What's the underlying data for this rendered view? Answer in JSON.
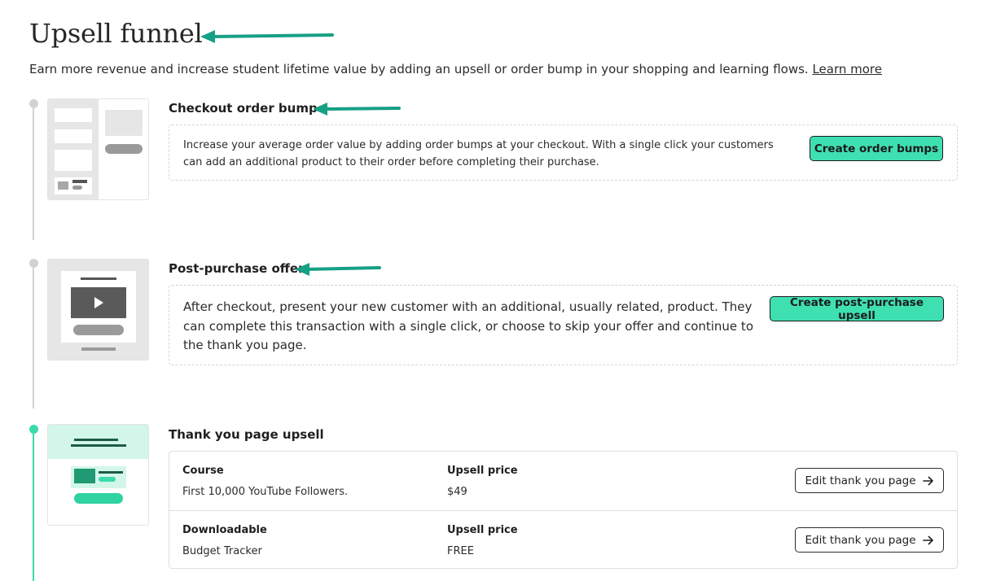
{
  "header": {
    "title": "Upsell funnel",
    "description": "Earn more revenue and increase student lifetime value by adding an upsell or order bump in your shopping and learning flows.",
    "learn_more": "Learn more"
  },
  "colors": {
    "accent": "#3ee0b2",
    "arrow": "#16a085",
    "timeline_inactive": "#d2d2d2",
    "timeline_active": "#3dd9ad"
  },
  "sections": {
    "order_bump": {
      "title": "Checkout order bump",
      "description": "Increase your average order value by adding order bumps at your checkout. With a single click your customers can add an additional product to their order before completing their purchase.",
      "button": "Create order bumps"
    },
    "post_purchase": {
      "title": "Post-purchase offer",
      "description": "After checkout, present your new customer with an additional, usually related, product. They can complete this transaction with a single click, or choose to skip your offer and continue to the thank you page.",
      "button": "Create post-purchase upsell"
    },
    "thank_you": {
      "title": "Thank you page upsell",
      "rows": [
        {
          "type_label": "Course",
          "product": "First 10,000 YouTube Followers.",
          "price_label": "Upsell price",
          "price": "$49",
          "button": "Edit thank you page"
        },
        {
          "type_label": "Downloadable",
          "product": "Budget Tracker",
          "price_label": "Upsell price",
          "price": "FREE",
          "button": "Edit thank you page"
        }
      ]
    }
  }
}
